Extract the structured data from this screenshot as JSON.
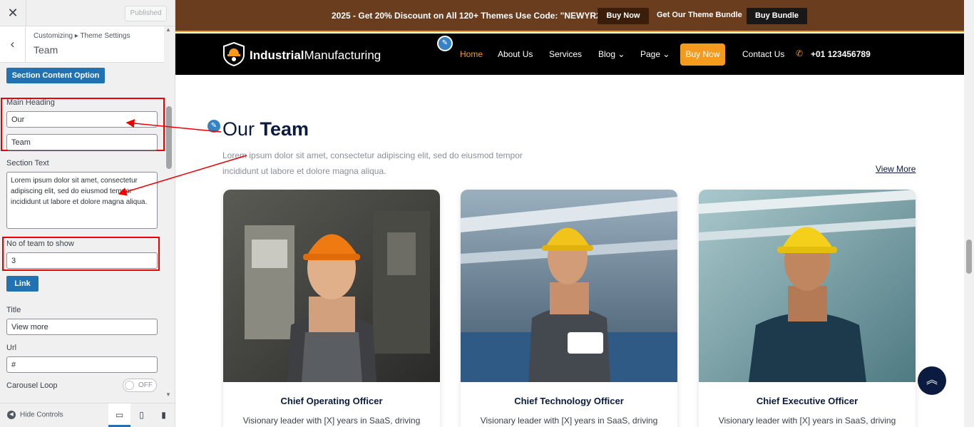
{
  "customizer": {
    "close": "✕",
    "publish_label": "Published",
    "breadcrumb": "Customizing ▸ Theme Settings",
    "section_title": "Team",
    "section_content_button": "Section Content Option",
    "main_heading_label": "Main Heading",
    "main_heading_value1": "Our",
    "main_heading_value2": "Team",
    "section_text_label": "Section Text",
    "section_text_value": "Lorem ipsum dolor sit amet, consectetur adipiscing elit, sed do eiusmod tempor incididunt ut labore et dolore magna aliqua.",
    "team_count_label": "No of team to show",
    "team_count_value": "3",
    "link_button": "Link",
    "title_label": "Title",
    "title_value": "View more",
    "url_label": "Url",
    "url_value": "#",
    "carousel_label": "Carousel Loop",
    "carousel_state": "OFF",
    "hide_controls": "Hide Controls",
    "accent_color": "#2271b1",
    "highlight_color": "#e00000"
  },
  "site": {
    "promo_text": "2025 - Get 20% Discount on All 120+ Themes Use Code: \"NEWYR2025\"",
    "buy_now_top": "Buy Now",
    "theme_bundle_text": "Get Our Theme Bundle",
    "buy_bundle": "Buy Bundle",
    "logo_bold": "Industrial",
    "logo_light": "Manufacturing",
    "nav": {
      "home": "Home",
      "about": "About Us",
      "services": "Services",
      "blog": "Blog",
      "page": "Page",
      "buy_now": "Buy Now",
      "contact": "Contact Us",
      "phone": "+01 123456789"
    },
    "heading_light": "Our",
    "heading_bold": "Team",
    "section_text": "Lorem ipsum dolor sit amet, consectetur adipiscing elit, sed do eiusmod tempor incididunt ut labore et dolore magna aliqua.",
    "view_more": "View More",
    "cards": [
      {
        "title": "Chief Operating Officer",
        "desc": "Visionary leader with [X] years in SaaS, driving"
      },
      {
        "title": "Chief Technology Officer",
        "desc": "Visionary leader with [X] years in SaaS, driving"
      },
      {
        "title": "Chief Executive Officer",
        "desc": "Visionary leader with [X] years in SaaS, driving"
      }
    ],
    "brand_color": "#6a3d1f",
    "accent_color": "#f39a1f",
    "navy_color": "#0b1b3f"
  }
}
